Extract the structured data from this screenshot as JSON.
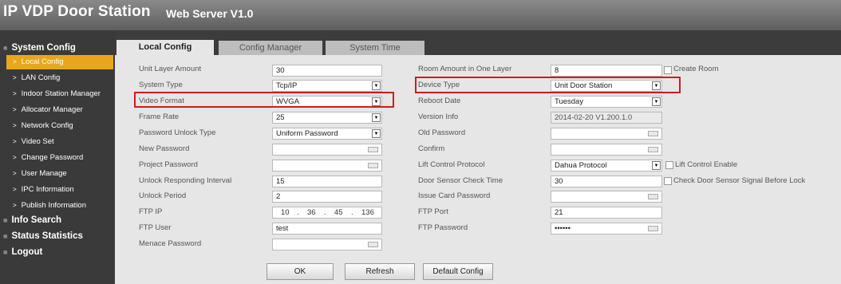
{
  "app": {
    "title": "IP VDP Door Station",
    "subtitle": "Web Server V1.0"
  },
  "sidebar": {
    "sections": {
      "system_config": "System Config",
      "info_search": "Info Search",
      "status_statistics": "Status Statistics",
      "logout": "Logout"
    },
    "items": [
      {
        "label": "Local Config",
        "active": true
      },
      {
        "label": "LAN Config"
      },
      {
        "label": "Indoor Station Manager"
      },
      {
        "label": "Allocator Manager"
      },
      {
        "label": "Network Config"
      },
      {
        "label": "Video Set"
      },
      {
        "label": "Change Password"
      },
      {
        "label": "User Manage"
      },
      {
        "label": "IPC Information"
      },
      {
        "label": "Publish Information"
      }
    ]
  },
  "tabs": [
    "Local Config",
    "Config Manager",
    "System Time"
  ],
  "form": {
    "unit_layer_amount": {
      "label": "Unit Layer Amount",
      "value": "30"
    },
    "system_type": {
      "label": "System Type",
      "value": "Tcp/IP"
    },
    "video_format": {
      "label": "Video Format",
      "value": "WVGA"
    },
    "frame_rate": {
      "label": "Frame Rate",
      "value": "25"
    },
    "password_unlock_type": {
      "label": "Password Unlock Type",
      "value": "Uniform Password"
    },
    "new_password": {
      "label": "New Password",
      "value": ""
    },
    "project_password": {
      "label": "Project Password",
      "value": ""
    },
    "unlock_responding_interval": {
      "label": "Unlock Responding Interval",
      "value": "15"
    },
    "unlock_period": {
      "label": "Unlock Period",
      "value": "2"
    },
    "ftp_ip": {
      "label": "FTP IP",
      "octets": [
        "10",
        "36",
        "45",
        "136"
      ],
      "sep": "."
    },
    "ftp_user": {
      "label": "FTP User",
      "value": "test"
    },
    "menace_password": {
      "label": "Menace Password",
      "value": ""
    },
    "room_amount": {
      "label": "Room Amount in One Layer",
      "value": "8"
    },
    "create_room": {
      "label": "Create Room",
      "checked": false
    },
    "device_type": {
      "label": "Device Type",
      "value": "Unit Door Station"
    },
    "reboot_date": {
      "label": "Reboot Date",
      "value": "Tuesday"
    },
    "version_info": {
      "label": "Version Info",
      "value": "2014-02-20 V1.200.1.0"
    },
    "old_password": {
      "label": "Old Password",
      "value": ""
    },
    "confirm": {
      "label": "Confirm",
      "value": ""
    },
    "lift_control_protocol": {
      "label": "Lift Control Protocol",
      "value": "Dahua Protocol"
    },
    "lift_control_enable": {
      "label": "Lift Control Enable",
      "checked": false
    },
    "door_sensor_check_time": {
      "label": "Door Sensor Check Time",
      "value": "30"
    },
    "check_door_sensor": {
      "label": "Check Door Sensor Signal Before Lock",
      "checked": false
    },
    "issue_card_password": {
      "label": "Issue Card Password",
      "value": ""
    },
    "ftp_port": {
      "label": "FTP Port",
      "value": "21"
    },
    "ftp_password": {
      "label": "FTP Password",
      "value": "••••••"
    }
  },
  "buttons": {
    "ok": "OK",
    "refresh": "Refresh",
    "default_config": "Default Config"
  },
  "colors": {
    "active_sidebar": "#e8a71a",
    "highlight": "#d21b1b"
  }
}
